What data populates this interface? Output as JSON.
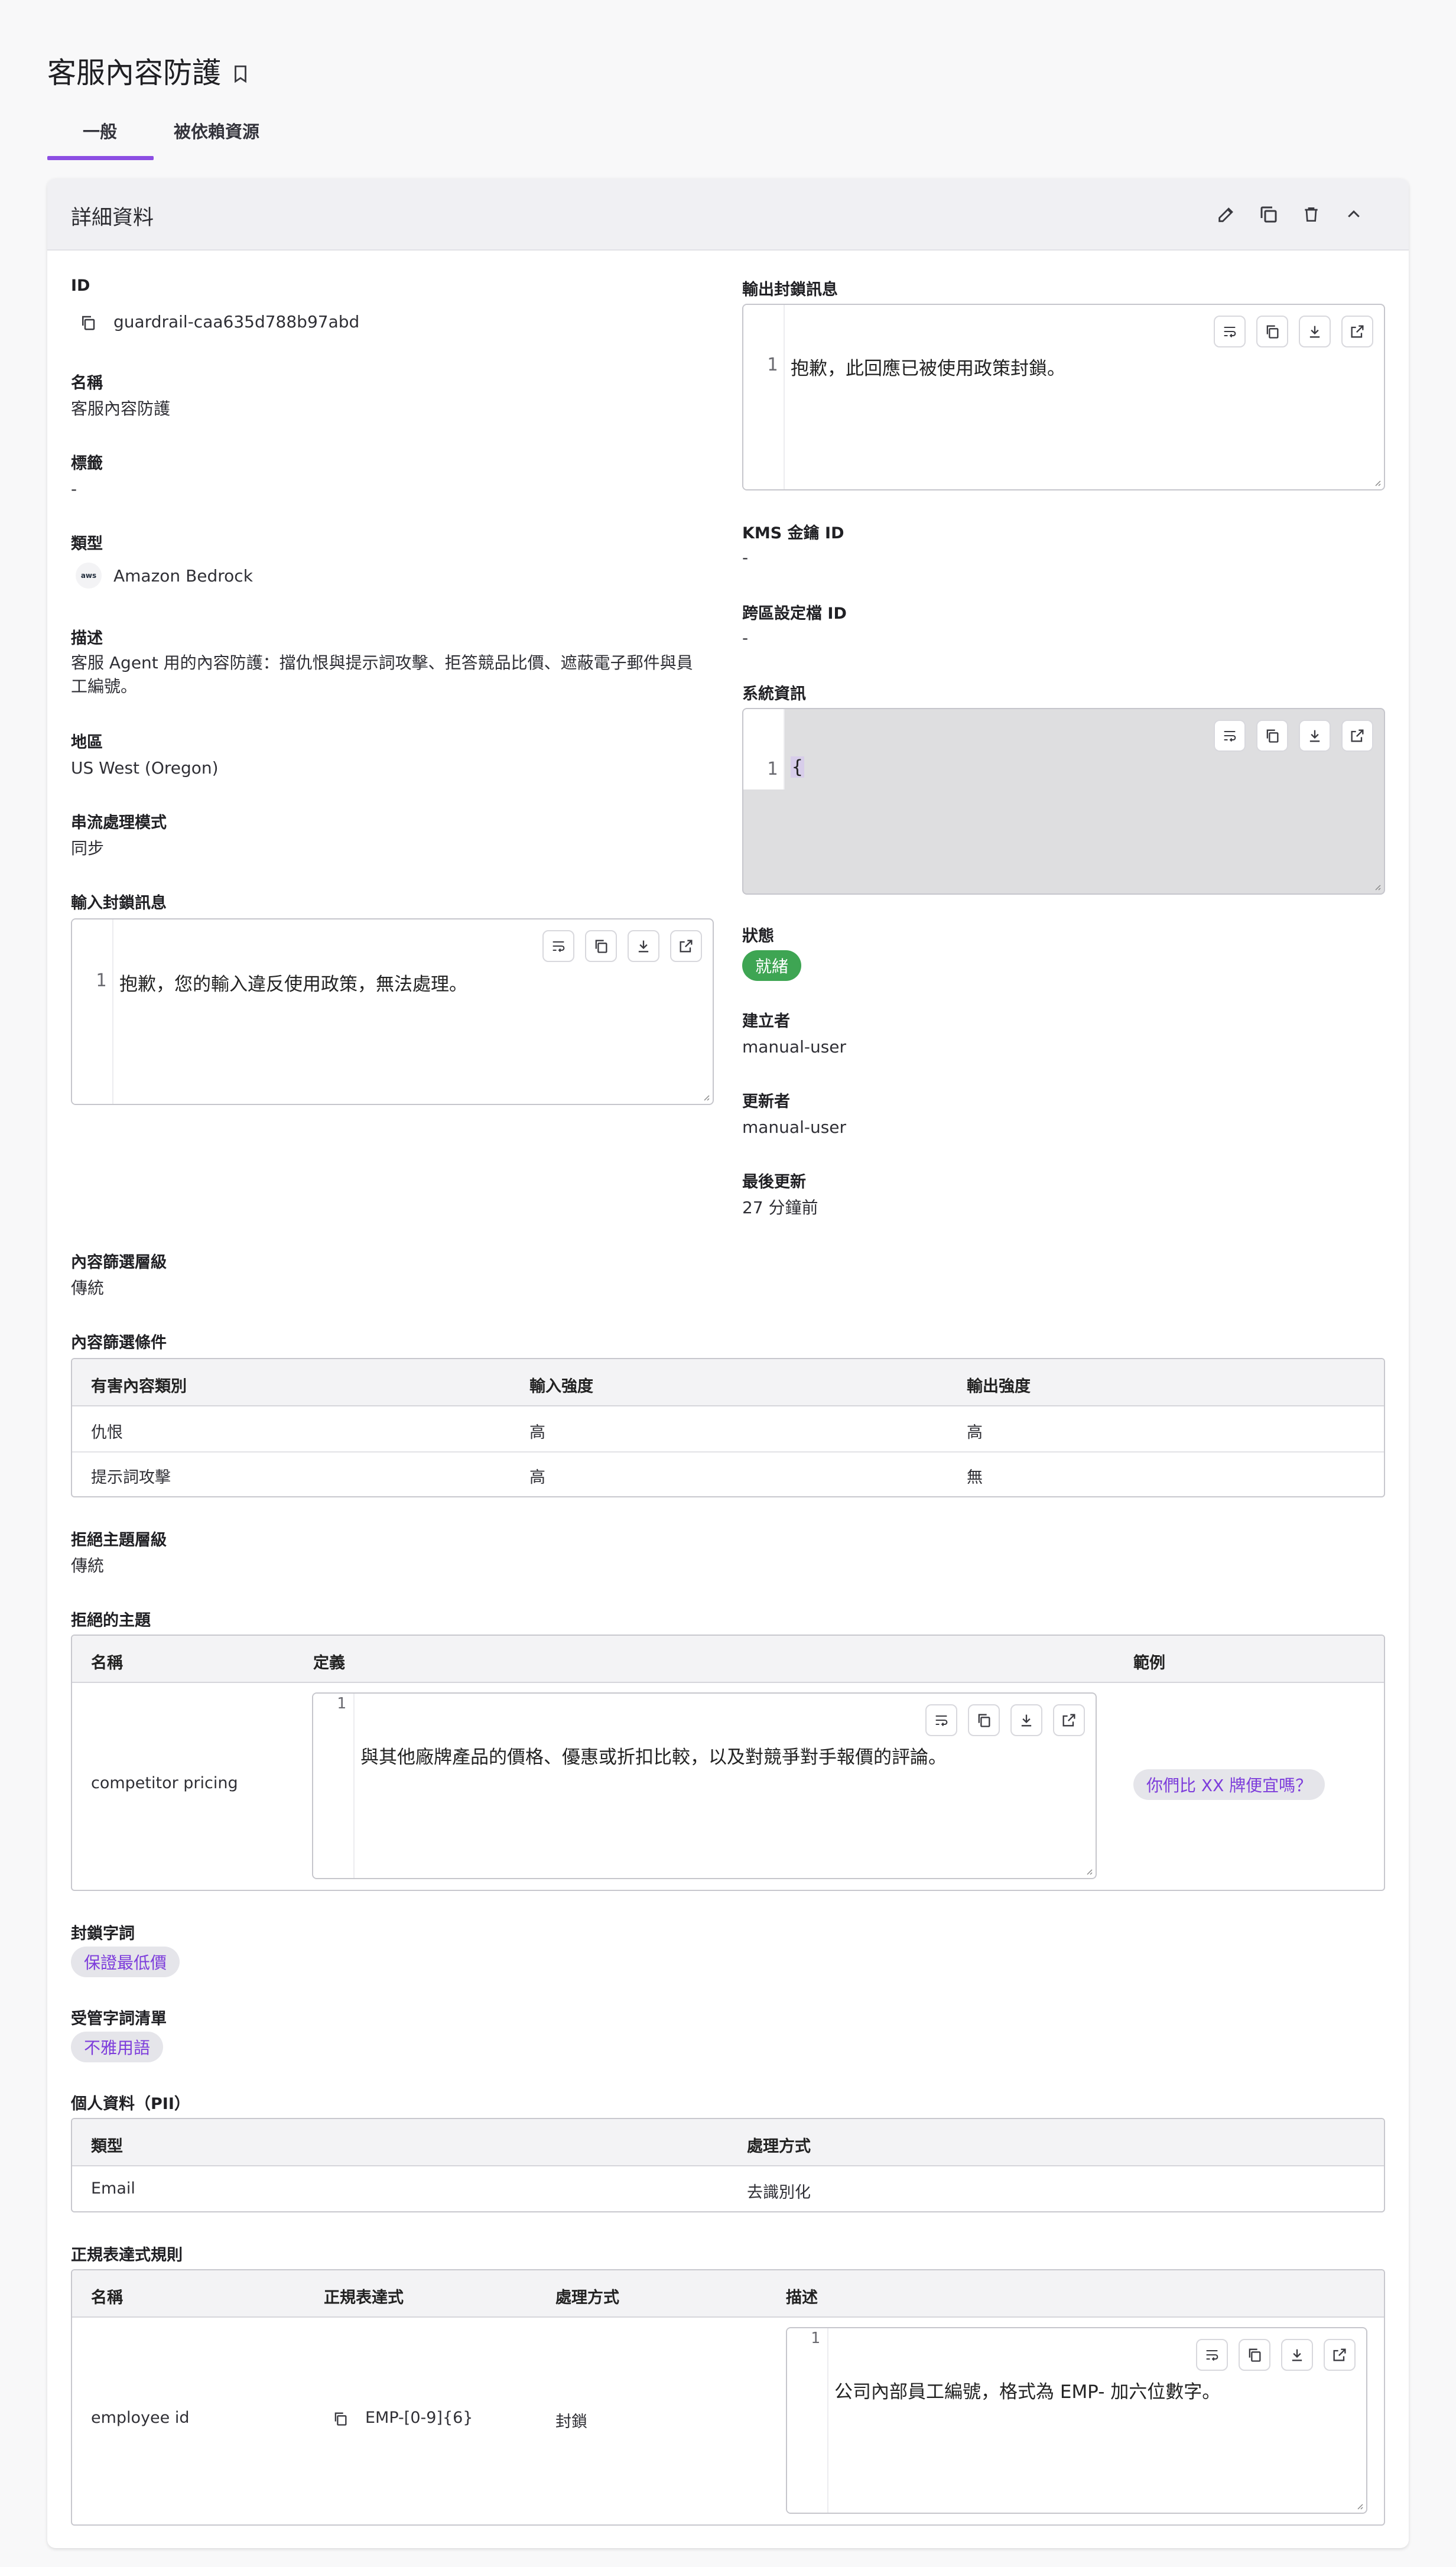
{
  "page": {
    "title": "客服內容防護",
    "tabs": [
      "一般",
      "被依賴資源"
    ]
  },
  "card": {
    "title": "詳細資料"
  },
  "left": {
    "id_label": "ID",
    "id_value": "guardrail-caa635d788b97abd",
    "name_label": "名稱",
    "name_value": "客服內容防護",
    "tags_label": "標籤",
    "tags_value": "-",
    "type_label": "類型",
    "type_value": "Amazon Bedrock",
    "type_logo": "aws",
    "desc_label": "描述",
    "desc_line1": "客服 Agent 用的內容防護：擋仇恨與提示詞攻擊、拒答競品比價、遮蔽電子郵件與員",
    "desc_line2": "工編號。",
    "region_label": "地區",
    "region_value": "US West (Oregon)",
    "stream_label": "串流處理模式",
    "stream_value": "同步",
    "input_block_label": "輸入封鎖訊息",
    "input_block_lineno": "1",
    "input_block_text": "抱歉，您的輸入違反使用政策，無法處理。"
  },
  "right": {
    "output_block_label": "輸出封鎖訊息",
    "output_block_lineno": "1",
    "output_block_text": "抱歉，此回應已被使用政策封鎖。",
    "kms_label": "KMS 金鑰 ID",
    "kms_value": "-",
    "cross_label": "跨區設定檔 ID",
    "cross_value": "-",
    "sys_label": "系統資訊",
    "sys_lineno": "1",
    "sys_text": "{",
    "status_label": "狀態",
    "status_value": "就緒",
    "status_color": "#3ea553",
    "creator_label": "建立者",
    "creator_value": "manual-user",
    "updater_label": "更新者",
    "updater_value": "manual-user",
    "updated_label": "最後更新",
    "updated_value": "27 分鐘前"
  },
  "content_filter": {
    "tier_label": "內容篩選層級",
    "tier_value": "傳統",
    "cond_label": "內容篩選條件",
    "headers": [
      "有害內容類別",
      "輸入強度",
      "輸出強度"
    ],
    "rows": [
      [
        "仇恨",
        "高",
        "高"
      ],
      [
        "提示詞攻擊",
        "高",
        "無"
      ]
    ]
  },
  "denied_topics": {
    "tier_label": "拒絕主題層級",
    "tier_value": "傳統",
    "label": "拒絕的主題",
    "headers": [
      "名稱",
      "定義",
      "範例"
    ],
    "row": {
      "name": "competitor pricing",
      "lineno": "1",
      "definition": "與其他廠牌產品的價格、優惠或折扣比較，以及對競爭對手報價的評論。",
      "example": "你們比 XX 牌便宜嗎？"
    }
  },
  "words": {
    "blocked_label": "封鎖字詞",
    "blocked_chip": "保證最低價",
    "managed_label": "受管字詞清單",
    "managed_chip": "不雅用語"
  },
  "pii": {
    "label": "個人資料（PII）",
    "headers": [
      "類型",
      "處理方式"
    ],
    "row": [
      "Email",
      "去識別化"
    ]
  },
  "regex": {
    "label": "正規表達式規則",
    "headers": [
      "名稱",
      "正規表達式",
      "處理方式",
      "描述"
    ],
    "row": {
      "name": "employee id",
      "pattern": "EMP-[0-9]{6}",
      "action": "封鎖",
      "lineno": "1",
      "desc": "公司內部員工編號，格式為 EMP- 加六位數字。"
    }
  },
  "colors": {
    "accent": "#8c4ee3",
    "chip_text": "#7d3ddb"
  }
}
